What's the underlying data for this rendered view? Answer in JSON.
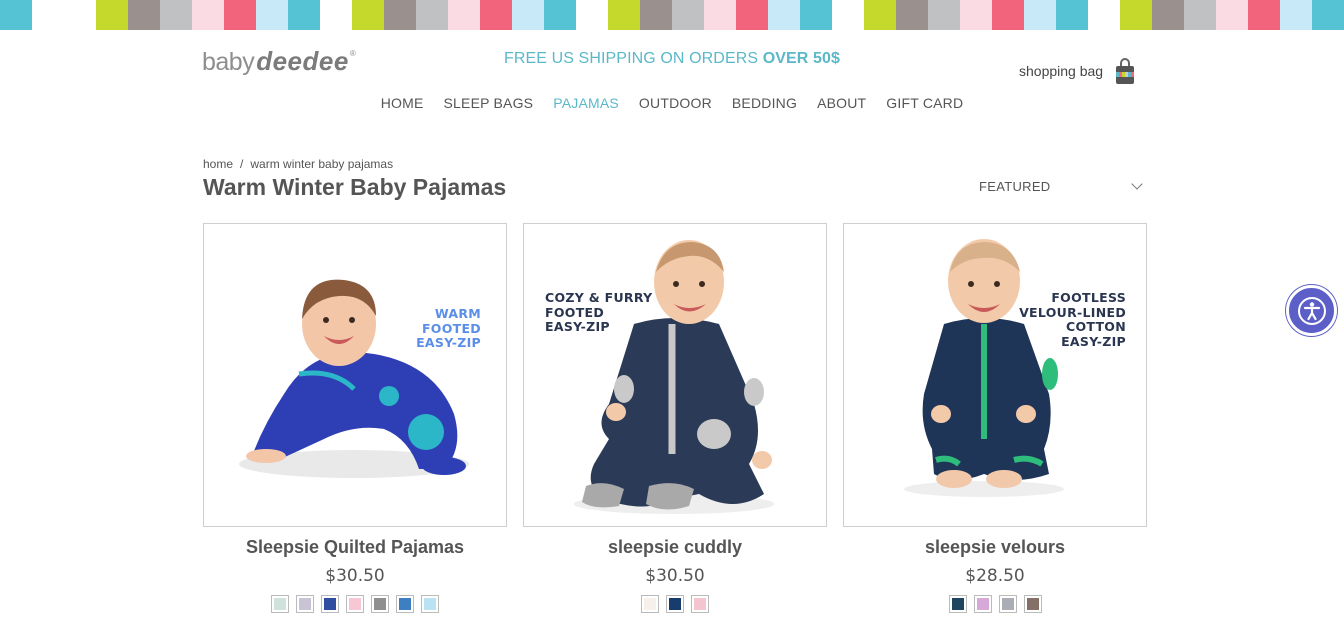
{
  "stripe_colors": [
    "#55c3d3",
    "#ffffff",
    "#ffffff",
    "#c5d92d",
    "#9a908d",
    "#bfc1c3",
    "#fadbe3",
    "#f2637c",
    "#c8e9f8",
    "#55c3d3",
    "#ffffff",
    "#c5d92d",
    "#9a908d",
    "#bfc1c3",
    "#fadbe3",
    "#f2637c",
    "#c8e9f8",
    "#55c3d3",
    "#ffffff",
    "#c5d92d",
    "#9a908d",
    "#bfc1c3",
    "#fadbe3",
    "#f2637c",
    "#c8e9f8",
    "#55c3d3",
    "#ffffff",
    "#c5d92d",
    "#9a908d",
    "#bfc1c3",
    "#fadbe3",
    "#f2637c",
    "#c8e9f8",
    "#55c3d3",
    "#ffffff",
    "#c5d92d",
    "#9a908d",
    "#bfc1c3",
    "#fadbe3",
    "#f2637c",
    "#c8e9f8",
    "#55c3d3"
  ],
  "brand": {
    "logo_part1": "baby",
    "logo_part2": "deedee",
    "logo_mark": "®",
    "accent": "#5ab8c9"
  },
  "promo": {
    "text": "FREE US SHIPPING ON ORDERS ",
    "highlight": "OVER 50$"
  },
  "header": {
    "bag_label": "shopping bag",
    "bag_icon": "shopping-bag-icon"
  },
  "nav": {
    "items": [
      {
        "label": "HOME"
      },
      {
        "label": "SLEEP BAGS"
      },
      {
        "label": "PAJAMAS",
        "active": true
      },
      {
        "label": "OUTDOOR"
      },
      {
        "label": "BEDDING"
      },
      {
        "label": "ABOUT"
      },
      {
        "label": "GIFT CARD"
      }
    ]
  },
  "breadcrumb": {
    "home": "home",
    "separator": "/",
    "current": "warm winter baby pajamas"
  },
  "page": {
    "title": "Warm Winter Baby Pajamas",
    "sort_label": "FEATURED"
  },
  "products": [
    {
      "name": "Sleepsie Quilted Pajamas",
      "price": "$30.50",
      "overlay": [
        "WARM",
        "FOOTED",
        "EASY-ZIP"
      ],
      "overlay_color": "#5b8ee8",
      "swatches": [
        "#cfe3dc",
        "#c9c3d6",
        "#2f4ea0",
        "#f7c8d3",
        "#8f8f8f",
        "#3d7fc0",
        "#b9e3f3"
      ]
    },
    {
      "name": "sleepsie cuddly",
      "price": "$30.50",
      "overlay": [
        "COZY & FURRY",
        "FOOTED",
        "EASY-ZIP"
      ],
      "overlay_color": "#2a3550",
      "swatches": [
        "#f7efe9",
        "#183c6e",
        "#f4c5cf"
      ]
    },
    {
      "name": "sleepsie velours",
      "price": "$28.50",
      "overlay": [
        "FOOTLESS",
        "VELOUR-LINED",
        "COTTON",
        "EASY-ZIP"
      ],
      "overlay_color": "#2a3550",
      "swatches": [
        "#1e4560",
        "#d6a9d8",
        "#a9aeb5",
        "#857068"
      ]
    }
  ],
  "accessibility": {
    "icon": "accessibility-icon"
  }
}
